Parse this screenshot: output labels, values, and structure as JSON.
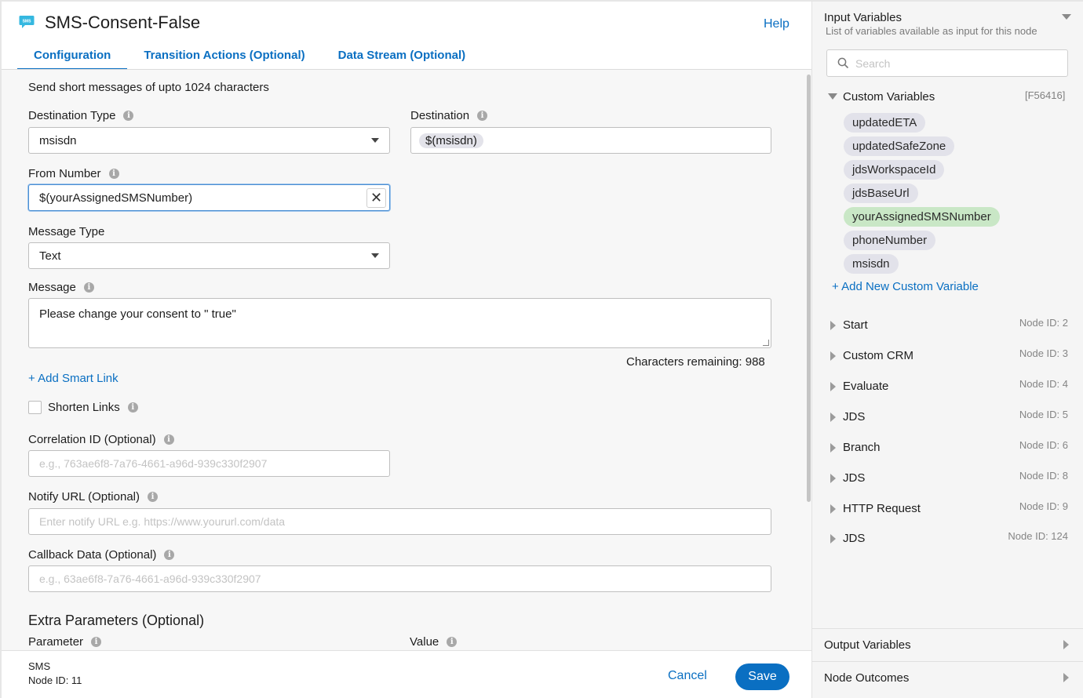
{
  "header": {
    "title": "SMS-Consent-False",
    "help": "Help",
    "sms_icon_text": "SMS"
  },
  "tabs": [
    {
      "label": "Configuration",
      "active": true
    },
    {
      "label": "Transition Actions (Optional)",
      "active": false
    },
    {
      "label": "Data Stream (Optional)",
      "active": false
    }
  ],
  "form": {
    "description": "Send short messages of upto 1024 characters",
    "destination_type": {
      "label": "Destination Type",
      "value": "msisdn"
    },
    "destination": {
      "label": "Destination",
      "value": "$(msisdn)"
    },
    "from_number": {
      "label": "From Number",
      "value": "$(yourAssignedSMSNumber)"
    },
    "message_type": {
      "label": "Message Type",
      "value": "Text"
    },
    "message": {
      "label": "Message",
      "value": "Please change your consent to \" true\""
    },
    "chars_remaining": "Characters remaining: 988",
    "add_smart_link": "+ Add Smart Link",
    "shorten_links": {
      "label": "Shorten Links",
      "checked": false
    },
    "correlation_id": {
      "label": "Correlation ID (Optional)",
      "placeholder": "e.g., 763ae6f8-7a76-4661-a96d-939c330f2907"
    },
    "notify_url": {
      "label": "Notify URL (Optional)",
      "placeholder": "Enter notify URL e.g. https://www.yoururl.com/data"
    },
    "callback_data": {
      "label": "Callback Data (Optional)",
      "placeholder": "e.g., 63ae6f8-7a76-4661-a96d-939c330f2907"
    },
    "extra_params": {
      "title": "Extra Parameters (Optional)",
      "parameter_label": "Parameter",
      "value_label": "Value"
    }
  },
  "footer": {
    "node_type": "SMS",
    "node_id": "Node ID: 11",
    "cancel": "Cancel",
    "save": "Save"
  },
  "input_vars": {
    "title": "Input Variables",
    "subtitle": "List of variables available as input for this node",
    "search_placeholder": "Search",
    "custom_label": "Custom Variables",
    "custom_id": "[F56416]",
    "variables": [
      {
        "name": "updatedETA",
        "selected": false
      },
      {
        "name": "updatedSafeZone",
        "selected": false
      },
      {
        "name": "jdsWorkspaceId",
        "selected": false
      },
      {
        "name": "jdsBaseUrl",
        "selected": false
      },
      {
        "name": "yourAssignedSMSNumber",
        "selected": true
      },
      {
        "name": "phoneNumber",
        "selected": false
      },
      {
        "name": "msisdn",
        "selected": false
      }
    ],
    "add_custom": "+ Add New Custom Variable",
    "nodes": [
      {
        "name": "Start",
        "id": "Node ID: 2"
      },
      {
        "name": "Custom CRM",
        "id": "Node ID: 3"
      },
      {
        "name": "Evaluate",
        "id": "Node ID: 4"
      },
      {
        "name": "JDS",
        "id": "Node ID: 5"
      },
      {
        "name": "Branch",
        "id": "Node ID: 6"
      },
      {
        "name": "JDS",
        "id": "Node ID: 8"
      },
      {
        "name": "HTTP Request",
        "id": "Node ID: 9"
      },
      {
        "name": "JDS",
        "id": "Node ID: 124"
      }
    ]
  },
  "output_vars": {
    "title": "Output Variables"
  },
  "node_outcomes": {
    "title": "Node Outcomes"
  },
  "colors": {
    "accent": "#0a6fc2",
    "selected_chip": "#c9e7c6",
    "chip": "#e2e2ea"
  }
}
